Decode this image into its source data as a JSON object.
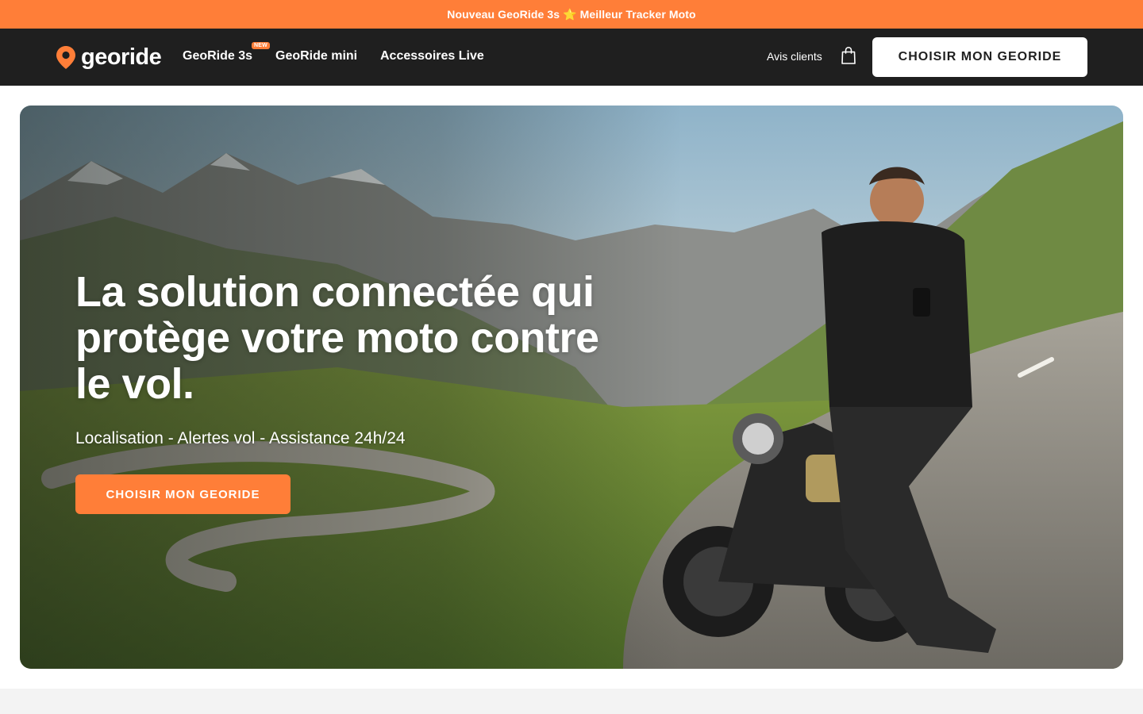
{
  "promo": {
    "text": "Nouveau GeoRide 3s ⭐ Meilleur Tracker Moto"
  },
  "header": {
    "logo_text": "georide",
    "nav": [
      {
        "label": "GeoRide 3s",
        "badge": "NEW"
      },
      {
        "label": "GeoRide mini"
      },
      {
        "label": "Accessoires Live"
      }
    ],
    "reviews_label": "Avis clients",
    "cta_label": "CHOISIR MON GEORIDE"
  },
  "hero": {
    "title": "La solution connectée qui protège votre moto contre le vol.",
    "subtitle": "Localisation - Alertes vol - Assistance 24h/24",
    "cta_label": "CHOISIR MON GEORIDE"
  },
  "colors": {
    "accent": "#ff7e38",
    "nav_bg": "#1f1f1f",
    "white": "#ffffff",
    "strip": "#f3f3f3"
  },
  "icons": [
    "location-pin-icon",
    "shopping-bag-icon"
  ]
}
